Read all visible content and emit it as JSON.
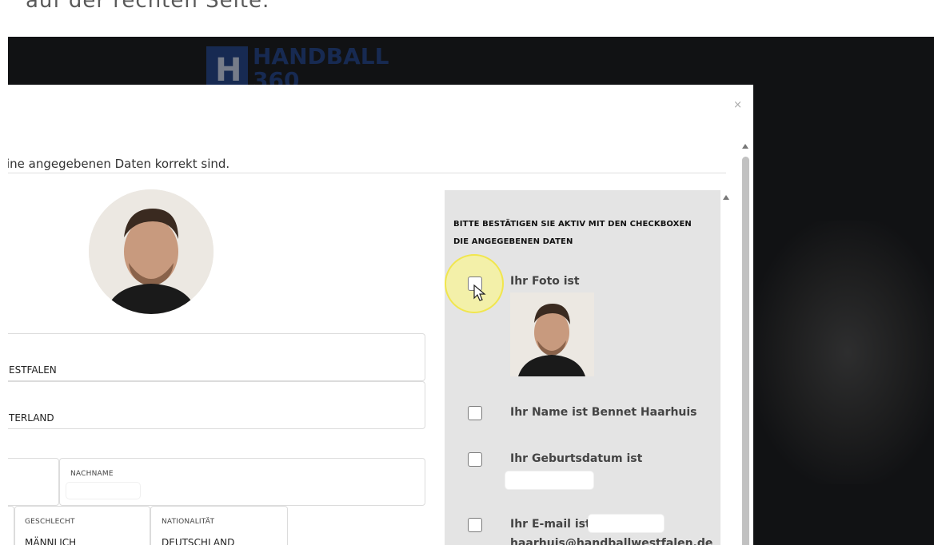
{
  "doc": {
    "snippet": "auf der rechten Seite."
  },
  "background": {
    "logo_letter": "H",
    "logo_text": "HANDBALL",
    "logo_sub": "360"
  },
  "modal": {
    "close_label": "×",
    "instruction": "ine angegebenen Daten korrekt sind."
  },
  "form": {
    "field_region_value": "ESTFALEN",
    "field_district_value": "TERLAND",
    "lastname_label": "NACHNAME",
    "gender_label": "GESCHLECHT",
    "gender_value": "MÄNNLICH",
    "nationality_label": "NATIONALITÄT",
    "nationality_value": "DEUTSCHLAND"
  },
  "confirm_panel": {
    "heading": "BITTE BESTÄTIGEN SIE AKTIV MIT DEN CHECKBOXEN DIE ANGEGEBENEN DATEN",
    "photo_label": "Ihr Foto ist",
    "name_label": "Ihr Name ist Bennet Haarhuis",
    "birthdate_label": "Ihr Geburtsdatum ist",
    "email_label": "Ihr E-mail ist",
    "email_value_partial": "haarhuis@handballwestfalen.de"
  },
  "colors": {
    "accent_logo": "#1d3f86",
    "panel_bg": "#e4e4e4",
    "highlight": "#fff678"
  }
}
